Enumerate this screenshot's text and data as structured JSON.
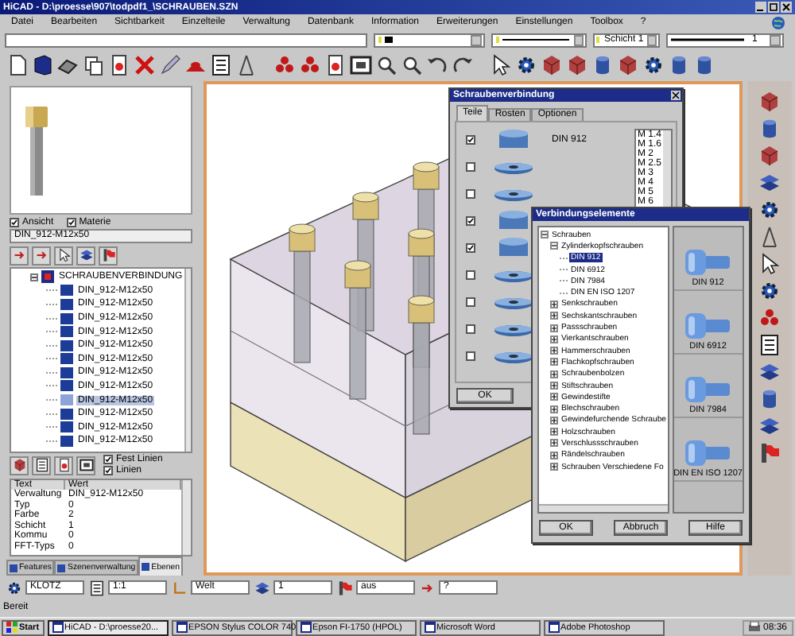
{
  "window": {
    "title": "HiCAD - D:\\proesse\\907\\todpdf1_\\SCHRAUBEN.SZN"
  },
  "menu": [
    "Datei",
    "Bearbeiten",
    "Sichtbarkeit",
    "Einzelteile",
    "Verwaltung",
    "Datenbank",
    "Information",
    "Erweiterungen",
    "Einstellungen",
    "Toolbox",
    "?"
  ],
  "attribute_bar": [
    {
      "kind": "color"
    },
    {
      "kind": "line"
    },
    {
      "kind": "layer",
      "label": "Schicht",
      "value": "1"
    },
    {
      "kind": "width",
      "value": "1"
    }
  ],
  "left_panel": {
    "view_options": [
      {
        "label": "Ansicht",
        "checked": true
      },
      {
        "label": "Materie",
        "checked": true
      }
    ],
    "part_name": "DIN_912-M12x50",
    "tree": {
      "label": "SCHRAUBENVERBINDUNG",
      "expanded": true,
      "children": [
        {
          "label": "DIN_912-M12x50",
          "selected": false
        },
        {
          "label": "DIN_912-M12x50",
          "selected": false
        },
        {
          "label": "DIN_912-M12x50",
          "selected": false
        },
        {
          "label": "DIN_912-M12x50",
          "selected": false
        },
        {
          "label": "DIN_912-M12x50",
          "selected": false
        },
        {
          "label": "DIN_912-M12x50",
          "selected": false
        },
        {
          "label": "DIN_912-M12x50",
          "selected": false
        },
        {
          "label": "DIN_912-M12x50",
          "selected": false
        },
        {
          "label": "DIN_912-M12x50",
          "selected": true
        },
        {
          "label": "DIN_912-M12x50",
          "selected": false
        },
        {
          "label": "DIN_912-M12x50",
          "selected": false
        },
        {
          "label": "DIN_912-M12x50",
          "selected": false
        }
      ]
    },
    "line_options": [
      {
        "label": "Fest Linien",
        "checked": true
      },
      {
        "label": "Linien",
        "checked": true
      }
    ],
    "properties": {
      "columns": [
        "Text",
        "Wert"
      ],
      "rows": [
        [
          "Verwaltung",
          "DIN_912-M12x50"
        ],
        [
          "Typ",
          "0"
        ],
        [
          "Farbe",
          "2"
        ],
        [
          "Schicht",
          "1"
        ],
        [
          "Kommu",
          "0"
        ],
        [
          "FFT-Typs",
          "0"
        ]
      ]
    },
    "tabs": [
      {
        "label": "Features",
        "selected": false
      },
      {
        "label": "Szenenverwaltung",
        "selected": false
      },
      {
        "label": "Ebenen",
        "selected": true
      }
    ]
  },
  "screw_dialog": {
    "title": "Schraubenverbindung",
    "tabs": [
      {
        "label": "Teile",
        "selected": true
      },
      {
        "label": "Rosten",
        "selected": false
      },
      {
        "label": "Optionen",
        "selected": false
      }
    ],
    "parts": [
      {
        "checked": true,
        "label": "DIN 912"
      },
      {
        "checked": false
      },
      {
        "checked": false
      },
      {
        "checked": true
      },
      {
        "checked": true
      },
      {
        "checked": false
      },
      {
        "checked": false
      },
      {
        "checked": false
      },
      {
        "checked": false
      }
    ],
    "sizes": [
      {
        "label": "M 1.4",
        "selected": false
      },
      {
        "label": "M 1.6",
        "selected": false
      },
      {
        "label": "M 2",
        "selected": false
      },
      {
        "label": "M 2.5",
        "selected": false
      },
      {
        "label": "M 3",
        "selected": false
      },
      {
        "label": "M 4",
        "selected": false
      },
      {
        "label": "M 5",
        "selected": false
      },
      {
        "label": "M 6",
        "selected": false
      }
    ],
    "buttons": [
      "OK"
    ]
  },
  "elements_dialog": {
    "title": "Verbindungselemente",
    "tree": [
      {
        "label": "Schrauben",
        "expanded": true,
        "selected": false,
        "children": [
          {
            "label": "Zylinderkopfschrauben",
            "expanded": true,
            "selected": false,
            "children": [
              {
                "label": "DIN 912",
                "selected": true
              },
              {
                "label": "DIN 6912",
                "selected": false
              },
              {
                "label": "DIN 7984",
                "selected": false
              },
              {
                "label": "DIN EN ISO 1207",
                "selected": false
              }
            ]
          },
          {
            "label": "Senkschrauben",
            "expanded": false,
            "selected": false
          },
          {
            "label": "Sechskantschrauben",
            "expanded": false,
            "selected": false
          },
          {
            "label": "Passschrauben",
            "expanded": false,
            "selected": false
          },
          {
            "label": "Vierkantschrauben",
            "expanded": false,
            "selected": false
          },
          {
            "label": "Hammerschrauben",
            "expanded": false,
            "selected": false
          },
          {
            "label": "Flachkopfschrauben",
            "expanded": false,
            "selected": false
          },
          {
            "label": "Schraubenbolzen",
            "expanded": false,
            "selected": false
          },
          {
            "label": "Stiftschrauben",
            "expanded": false,
            "selected": false
          },
          {
            "label": "Gewindestifte",
            "expanded": false,
            "selected": false
          },
          {
            "label": "Blechschrauben",
            "expanded": false,
            "selected": false
          },
          {
            "label": "Gewindefurchende Schraube",
            "expanded": false,
            "selected": false
          },
          {
            "label": "Holzschrauben",
            "expanded": false,
            "selected": false
          },
          {
            "label": "Verschlussschrauben",
            "expanded": false,
            "selected": false
          },
          {
            "label": "Rändelschrauben",
            "expanded": false,
            "selected": false
          },
          {
            "label": "Schrauben Verschiedene Fo",
            "expanded": false,
            "selected": false
          }
        ]
      }
    ],
    "previews": [
      "DIN 912",
      "DIN 6912",
      "DIN 7984",
      "DIN EN ISO 1207"
    ],
    "buttons": [
      "OK",
      "Abbruch",
      "Hilfe"
    ]
  },
  "input_bar": [
    {
      "value": "KLOTZ"
    },
    {
      "value": "1:1"
    },
    {
      "value": "Welt"
    },
    {
      "value": "1"
    },
    {
      "value": "aus"
    },
    {
      "value": "?"
    }
  ],
  "status_bar": "Bereit",
  "taskbar": {
    "start": "Start",
    "tasks": [
      {
        "label": "HiCAD - D:\\proesse20...",
        "selected": true
      },
      {
        "label": "EPSON Stylus COLOR 740",
        "selected": false
      },
      {
        "label": "Epson FI-1750 (HPOL)",
        "selected": false
      },
      {
        "label": "Microsoft Word",
        "selected": false
      },
      {
        "label": "Adobe Photoshop",
        "selected": false
      }
    ],
    "clock": "08:36"
  }
}
